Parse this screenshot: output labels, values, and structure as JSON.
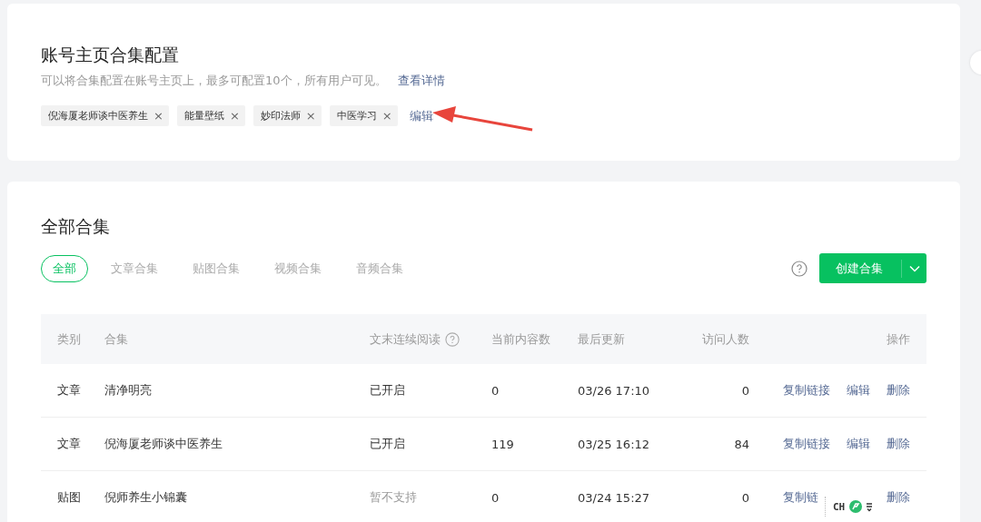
{
  "config": {
    "title": "账号主页合集配置",
    "description": "可以将合集配置在账号主页上，最多可配置10个，所有用户可见。",
    "details_link": "查看详情",
    "tags": [
      {
        "label": "倪海厦老师谈中医养生",
        "close": "×"
      },
      {
        "label": "能量壁纸",
        "close": "×"
      },
      {
        "label": "妙印法师",
        "close": "×"
      },
      {
        "label": "中医学习",
        "close": "×"
      }
    ],
    "edit_link": "编辑"
  },
  "collections": {
    "title": "全部合集",
    "tabs": [
      {
        "label": "全部",
        "selected": true
      },
      {
        "label": "文章合集",
        "selected": false
      },
      {
        "label": "贴图合集",
        "selected": false
      },
      {
        "label": "视频合集",
        "selected": false
      },
      {
        "label": "音频合集",
        "selected": false
      }
    ],
    "create_button": "创建合集",
    "table": {
      "columns": [
        "类别",
        "合集",
        "文末连续阅读",
        "当前内容数",
        "最后更新",
        "访问人数",
        "操作"
      ],
      "rows": [
        {
          "type": "文章",
          "name": "清净明亮",
          "continuous_reading": "已开启",
          "continuous_disabled": false,
          "count": "0",
          "updated": "03/26 17:10",
          "visitors": "0",
          "actions": [
            "复制链接",
            "编辑",
            "删除"
          ]
        },
        {
          "type": "文章",
          "name": "倪海厦老师谈中医养生",
          "continuous_reading": "已开启",
          "continuous_disabled": false,
          "count": "119",
          "updated": "03/25 16:12",
          "visitors": "84",
          "actions": [
            "复制链接",
            "编辑",
            "删除"
          ]
        },
        {
          "type": "贴图",
          "name": "倪师养生小锦囊",
          "continuous_reading": "暂不支持",
          "continuous_disabled": true,
          "count": "0",
          "updated": "03/24 15:27",
          "visitors": "0",
          "actions": [
            "复制链",
            "删除"
          ]
        }
      ]
    }
  },
  "ime_toolbar": {
    "language": "CH"
  }
}
